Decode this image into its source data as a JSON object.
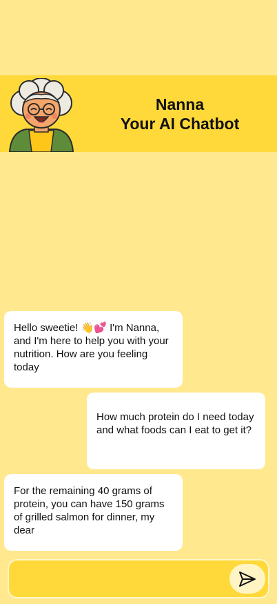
{
  "header": {
    "title_line1": "Nanna",
    "title_line2": "Your AI Chatbot",
    "avatar_icon": "grandma-avatar-icon"
  },
  "messages": [
    {
      "sender": "bot",
      "text": "Hello sweetie! 👋💕 I'm Nanna, and I'm here to help you with your nutrition. How are you feeling today"
    },
    {
      "sender": "user",
      "text": "How much protein do I need today and what foods can I eat to get it?"
    },
    {
      "sender": "bot",
      "text": "For the remaining 40 grams of protein, you can have 150 grams of grilled salmon for dinner, my dear"
    }
  ],
  "composer": {
    "value": "",
    "placeholder": "",
    "send_icon": "send-icon"
  },
  "colors": {
    "background": "#FFE88E",
    "header": "#FFD93A",
    "bubble": "#FFFFFF",
    "input": "#FFD93A",
    "send_button": "#FFF4C4"
  }
}
